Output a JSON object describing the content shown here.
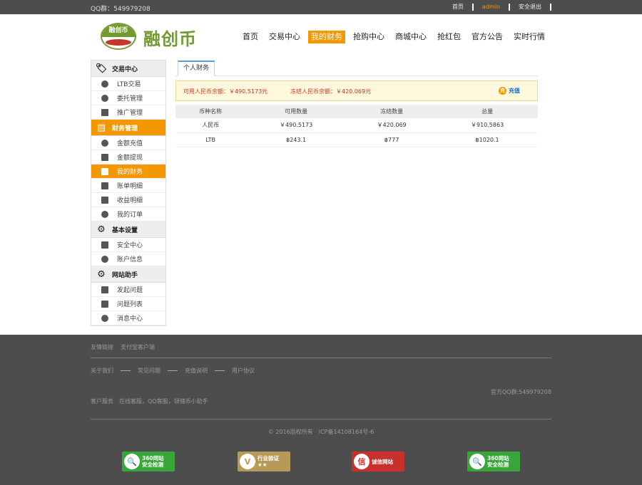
{
  "topbar": {
    "qq": "QQ群：549979208",
    "links": [
      "首页",
      "admin",
      "安全退出"
    ]
  },
  "logo": {
    "badge_text": "融创币",
    "name": "融创币"
  },
  "nav": [
    {
      "label": "首页",
      "active": false
    },
    {
      "label": "交易中心",
      "active": false
    },
    {
      "label": "我的财务",
      "active": true
    },
    {
      "label": "抢购中心",
      "active": false
    },
    {
      "label": "商城中心",
      "active": false
    },
    {
      "label": "抢红包",
      "active": false
    },
    {
      "label": "官方公告",
      "active": false
    },
    {
      "label": "实时行情",
      "active": false
    }
  ],
  "sidebar": {
    "sections": [
      {
        "title": "交易中心",
        "icon": "tag-icon",
        "items": [
          "LTB交易",
          "委托管理",
          "推广管理"
        ]
      },
      {
        "title": "财务管理",
        "icon": "ledger-icon",
        "items": [
          "金额充值",
          "金额提现",
          "我的财务",
          "账单明细",
          "收益明细",
          "我的订单"
        ]
      },
      {
        "title": "基本设置",
        "icon": "gear-icon",
        "items": [
          "安全中心",
          "账户信息"
        ]
      },
      {
        "title": "网站助手",
        "icon": "gear-icon",
        "items": [
          "发起问题",
          "问题列表",
          "消息中心"
        ]
      }
    ]
  },
  "content": {
    "tab": "个人财务",
    "notice": {
      "available": "可用人民币余额：￥490.5173元",
      "frozen": "冻结人民币余额：￥420.069元",
      "recharge_icon": "充",
      "recharge": "充值"
    },
    "table": {
      "headers": [
        "币种名称",
        "可用数量",
        "冻结数量",
        "总量"
      ],
      "rows": [
        [
          "人民币",
          "￥490.5173",
          "￥420.069",
          "￥910.5863"
        ],
        [
          "LTB",
          "฿243.1",
          "฿777",
          "฿1020.1"
        ]
      ]
    }
  },
  "footer": {
    "friend_links": [
      "友情链接",
      "支付宝客户端"
    ],
    "about": [
      "关于我们",
      "常见问题",
      "充值说明",
      "用户协议"
    ],
    "official_qq": "官方QQ群:549979208",
    "customer_service": "客户服务　在线客服，QQ客服，领储币小助手",
    "copyright": "© 2016版权所有　ICP备14108164号-6",
    "badges": [
      {
        "label": "360网站\n安全检测",
        "color": "green"
      },
      {
        "label": "行业验证\n★★",
        "color": "gold"
      },
      {
        "label": "诚信网站",
        "color": "red"
      },
      {
        "label": "360网站\n安全检测",
        "color": "green"
      }
    ]
  }
}
